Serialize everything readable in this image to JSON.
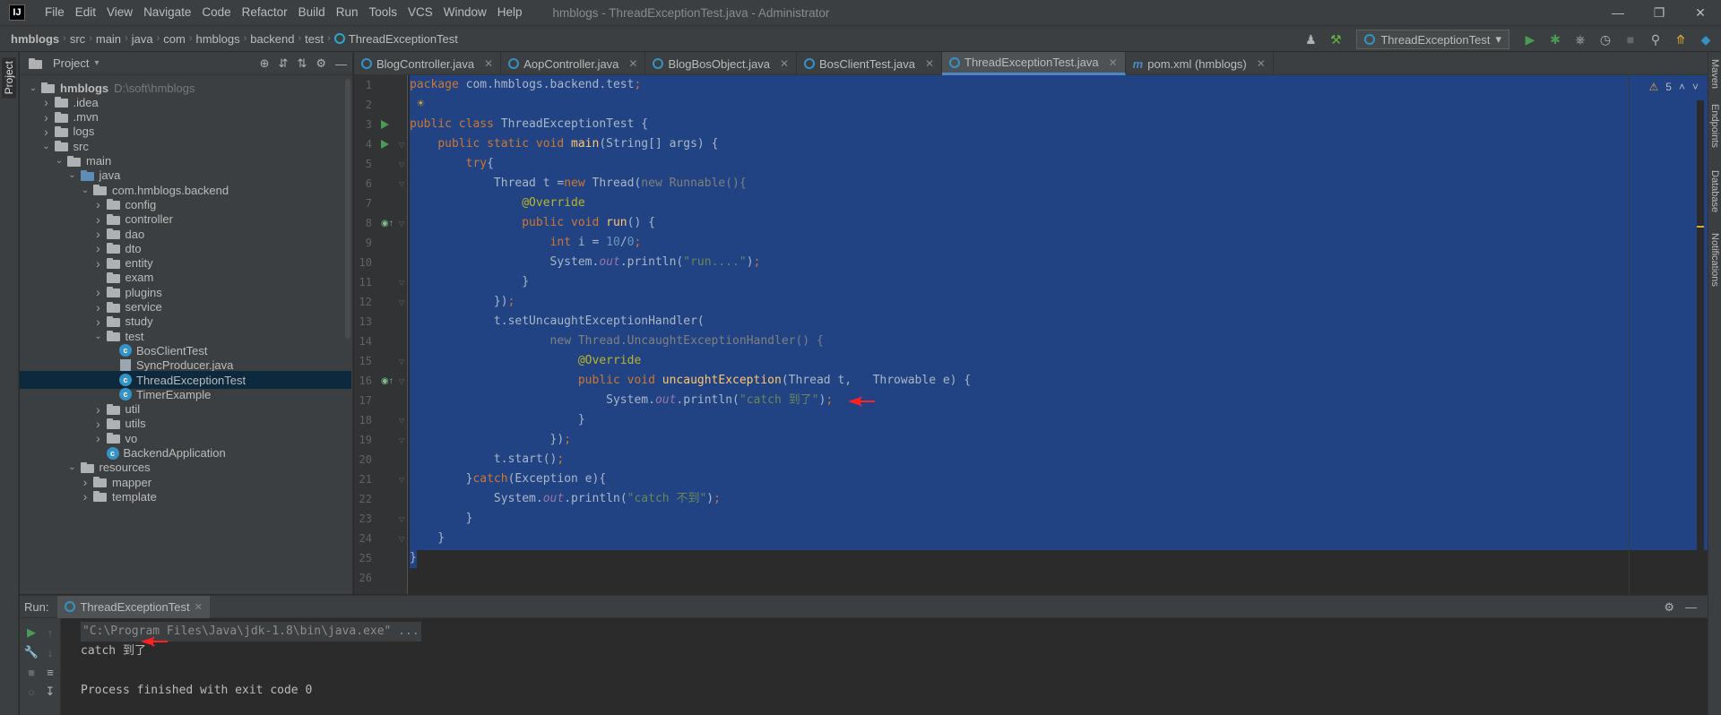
{
  "menu": [
    "File",
    "Edit",
    "View",
    "Navigate",
    "Code",
    "Refactor",
    "Build",
    "Run",
    "Tools",
    "VCS",
    "Window",
    "Help"
  ],
  "window_title": "hmblogs - ThreadExceptionTest.java - Administrator",
  "breadcrumb": [
    "hmblogs",
    "src",
    "main",
    "java",
    "com",
    "hmblogs",
    "backend",
    "test",
    "ThreadExceptionTest"
  ],
  "run_config": "ThreadExceptionTest",
  "project_panel": {
    "title": "Project",
    "tree": [
      {
        "label": "hmblogs",
        "hint": "D:\\soft\\hmblogs",
        "depth": 0,
        "expanded": true,
        "type": "folder",
        "bold": true
      },
      {
        "label": ".idea",
        "depth": 1,
        "expanded": false,
        "type": "folder"
      },
      {
        "label": ".mvn",
        "depth": 1,
        "expanded": false,
        "type": "folder"
      },
      {
        "label": "logs",
        "depth": 1,
        "expanded": false,
        "type": "folder"
      },
      {
        "label": "src",
        "depth": 1,
        "expanded": true,
        "type": "folder"
      },
      {
        "label": "main",
        "depth": 2,
        "expanded": true,
        "type": "folder"
      },
      {
        "label": "java",
        "depth": 3,
        "expanded": true,
        "type": "folder-blue"
      },
      {
        "label": "com.hmblogs.backend",
        "depth": 4,
        "expanded": true,
        "type": "folder"
      },
      {
        "label": "config",
        "depth": 5,
        "expanded": false,
        "type": "folder"
      },
      {
        "label": "controller",
        "depth": 5,
        "expanded": false,
        "type": "folder"
      },
      {
        "label": "dao",
        "depth": 5,
        "expanded": false,
        "type": "folder"
      },
      {
        "label": "dto",
        "depth": 5,
        "expanded": false,
        "type": "folder"
      },
      {
        "label": "entity",
        "depth": 5,
        "expanded": false,
        "type": "folder"
      },
      {
        "label": "exam",
        "depth": 5,
        "expanded": null,
        "type": "folder"
      },
      {
        "label": "plugins",
        "depth": 5,
        "expanded": false,
        "type": "folder"
      },
      {
        "label": "service",
        "depth": 5,
        "expanded": false,
        "type": "folder"
      },
      {
        "label": "study",
        "depth": 5,
        "expanded": false,
        "type": "folder"
      },
      {
        "label": "test",
        "depth": 5,
        "expanded": true,
        "type": "folder"
      },
      {
        "label": "BosClientTest",
        "depth": 6,
        "expanded": null,
        "type": "class"
      },
      {
        "label": "SyncProducer.java",
        "depth": 6,
        "expanded": null,
        "type": "file"
      },
      {
        "label": "ThreadExceptionTest",
        "depth": 6,
        "expanded": null,
        "type": "class",
        "selected": true
      },
      {
        "label": "TimerExample",
        "depth": 6,
        "expanded": null,
        "type": "class"
      },
      {
        "label": "util",
        "depth": 5,
        "expanded": false,
        "type": "folder"
      },
      {
        "label": "utils",
        "depth": 5,
        "expanded": false,
        "type": "folder"
      },
      {
        "label": "vo",
        "depth": 5,
        "expanded": false,
        "type": "folder"
      },
      {
        "label": "BackendApplication",
        "depth": 5,
        "expanded": null,
        "type": "class"
      },
      {
        "label": "resources",
        "depth": 3,
        "expanded": true,
        "type": "folder"
      },
      {
        "label": "mapper",
        "depth": 4,
        "expanded": false,
        "type": "folder"
      },
      {
        "label": "template",
        "depth": 4,
        "expanded": false,
        "type": "folder"
      }
    ]
  },
  "editor_tabs": [
    {
      "label": "BlogController.java",
      "icon": "class",
      "active": false
    },
    {
      "label": "AopController.java",
      "icon": "class",
      "active": false
    },
    {
      "label": "BlogBosObject.java",
      "icon": "class",
      "active": false
    },
    {
      "label": "BosClientTest.java",
      "icon": "class",
      "active": false
    },
    {
      "label": "ThreadExceptionTest.java",
      "icon": "class",
      "active": true
    },
    {
      "label": "pom.xml (hmblogs)",
      "icon": "maven",
      "active": false
    }
  ],
  "editor": {
    "warnings": "5",
    "lines": [
      [
        [
          "kw",
          "package"
        ],
        [
          "t",
          " com.hmblogs.backend.test"
        ],
        [
          "kw",
          ";"
        ]
      ],
      [],
      [
        [
          "kw",
          "public class"
        ],
        [
          "t",
          " ThreadExceptionTest {"
        ]
      ],
      [
        [
          "t",
          "    "
        ],
        [
          "kw",
          "public static void"
        ],
        [
          "t",
          " "
        ],
        [
          "fn",
          "main"
        ],
        [
          "t",
          "(String[] args) {"
        ]
      ],
      [
        [
          "t",
          "        "
        ],
        [
          "kw",
          "try"
        ],
        [
          "t",
          "{"
        ]
      ],
      [
        [
          "t",
          "            Thread t ="
        ],
        [
          "kw",
          "new"
        ],
        [
          "t",
          " Thread("
        ],
        [
          "gray",
          "new Runnable(){"
        ]
      ],
      [
        [
          "t",
          "                "
        ],
        [
          "ann",
          "@Override"
        ]
      ],
      [
        [
          "t",
          "                "
        ],
        [
          "kw",
          "public void"
        ],
        [
          "t",
          " "
        ],
        [
          "fn",
          "run"
        ],
        [
          "t",
          "() {"
        ]
      ],
      [
        [
          "t",
          "                    "
        ],
        [
          "kw",
          "int"
        ],
        [
          "t",
          " i = "
        ],
        [
          "num",
          "10"
        ],
        [
          "t",
          "/"
        ],
        [
          "num",
          "0"
        ],
        [
          "kw",
          ";"
        ]
      ],
      [
        [
          "t",
          "                    System."
        ],
        [
          "fld",
          "out"
        ],
        [
          "t",
          ".println("
        ],
        [
          "str",
          "\"run....\""
        ],
        [
          "t",
          ")"
        ],
        [
          "kw",
          ";"
        ]
      ],
      [
        [
          "t",
          "                }"
        ]
      ],
      [
        [
          "t",
          "            })"
        ],
        [
          "kw",
          ";"
        ]
      ],
      [
        [
          "t",
          "            t.setUncaughtExceptionHandler("
        ]
      ],
      [
        [
          "t",
          "                    "
        ],
        [
          "gray",
          "new Thread.UncaughtExceptionHandler() {"
        ]
      ],
      [
        [
          "t",
          "                        "
        ],
        [
          "ann",
          "@Override"
        ]
      ],
      [
        [
          "t",
          "                        "
        ],
        [
          "kw",
          "public void"
        ],
        [
          "t",
          " "
        ],
        [
          "fn",
          "uncaughtException"
        ],
        [
          "t",
          "(Thread t,   Throwable e) {"
        ]
      ],
      [
        [
          "t",
          "                            System."
        ],
        [
          "fld",
          "out"
        ],
        [
          "t",
          ".println("
        ],
        [
          "str",
          "\"catch 到了\""
        ],
        [
          "t",
          ")"
        ],
        [
          "kw",
          ";"
        ]
      ],
      [
        [
          "t",
          "                        }"
        ]
      ],
      [
        [
          "t",
          "                    })"
        ],
        [
          "kw",
          ";"
        ]
      ],
      [
        [
          "t",
          "            t.start()"
        ],
        [
          "kw",
          ";"
        ]
      ],
      [
        [
          "t",
          "        }"
        ],
        [
          "kw",
          "catch"
        ],
        [
          "t",
          "(Exception e){"
        ]
      ],
      [
        [
          "t",
          "            System."
        ],
        [
          "fld",
          "out"
        ],
        [
          "t",
          ".println("
        ],
        [
          "str",
          "\"catch 不到\""
        ],
        [
          "t",
          ")"
        ],
        [
          "kw",
          ";"
        ]
      ],
      [
        [
          "t",
          "        }"
        ]
      ],
      [
        [
          "t",
          "    }"
        ]
      ],
      [
        [
          "t",
          "}"
        ]
      ],
      []
    ]
  },
  "right_strip": [
    "Maven",
    "Endpoints",
    "Database",
    "Notifications"
  ],
  "run_panel": {
    "label": "Run:",
    "tab": "ThreadExceptionTest",
    "console": [
      {
        "text": "\"C:\\Program Files\\Java\\jdk-1.8\\bin\\java.exe\" ...",
        "kind": "cmd"
      },
      {
        "text": "catch 到了",
        "kind": "out"
      },
      {
        "text": "",
        "kind": "out"
      },
      {
        "text": "Process finished with exit code 0",
        "kind": "out"
      }
    ]
  },
  "colors": {
    "selection": "#214283",
    "accent": "#4a88c7",
    "run_green": "#499c54",
    "arrow_red": "#ff2020"
  }
}
